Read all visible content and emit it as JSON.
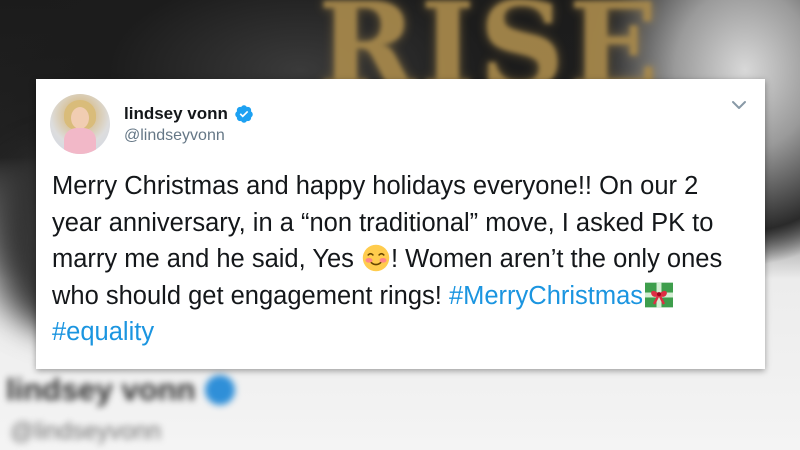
{
  "background": {
    "banner_text": "RISE",
    "blurred_name": "lindsey vonn",
    "blurred_handle": "@lindseyvonn"
  },
  "tweet": {
    "author": {
      "display_name": "lindsey vonn",
      "handle": "@lindseyvonn",
      "verified": true,
      "icon": "verified-badge-icon"
    },
    "menu_icon": "chevron-down-icon",
    "text": {
      "part1": "Merry Christmas and happy holidays everyone!! On our 2 year anniversary, in a “non traditional” move, I asked PK to marry me and he said, Yes",
      "emoji1": "smiling-face-with-blush-icon",
      "part2": "! Women aren’t the only ones who should get engagement rings!",
      "hashtag1": "#MerryChristmas",
      "emoji2": "wrapped-gift-icon",
      "hashtag2": "#equality"
    },
    "colors": {
      "link": "#1b95e0",
      "text": "#14171a",
      "handle": "#657786",
      "verified": "#1da1f2"
    }
  }
}
